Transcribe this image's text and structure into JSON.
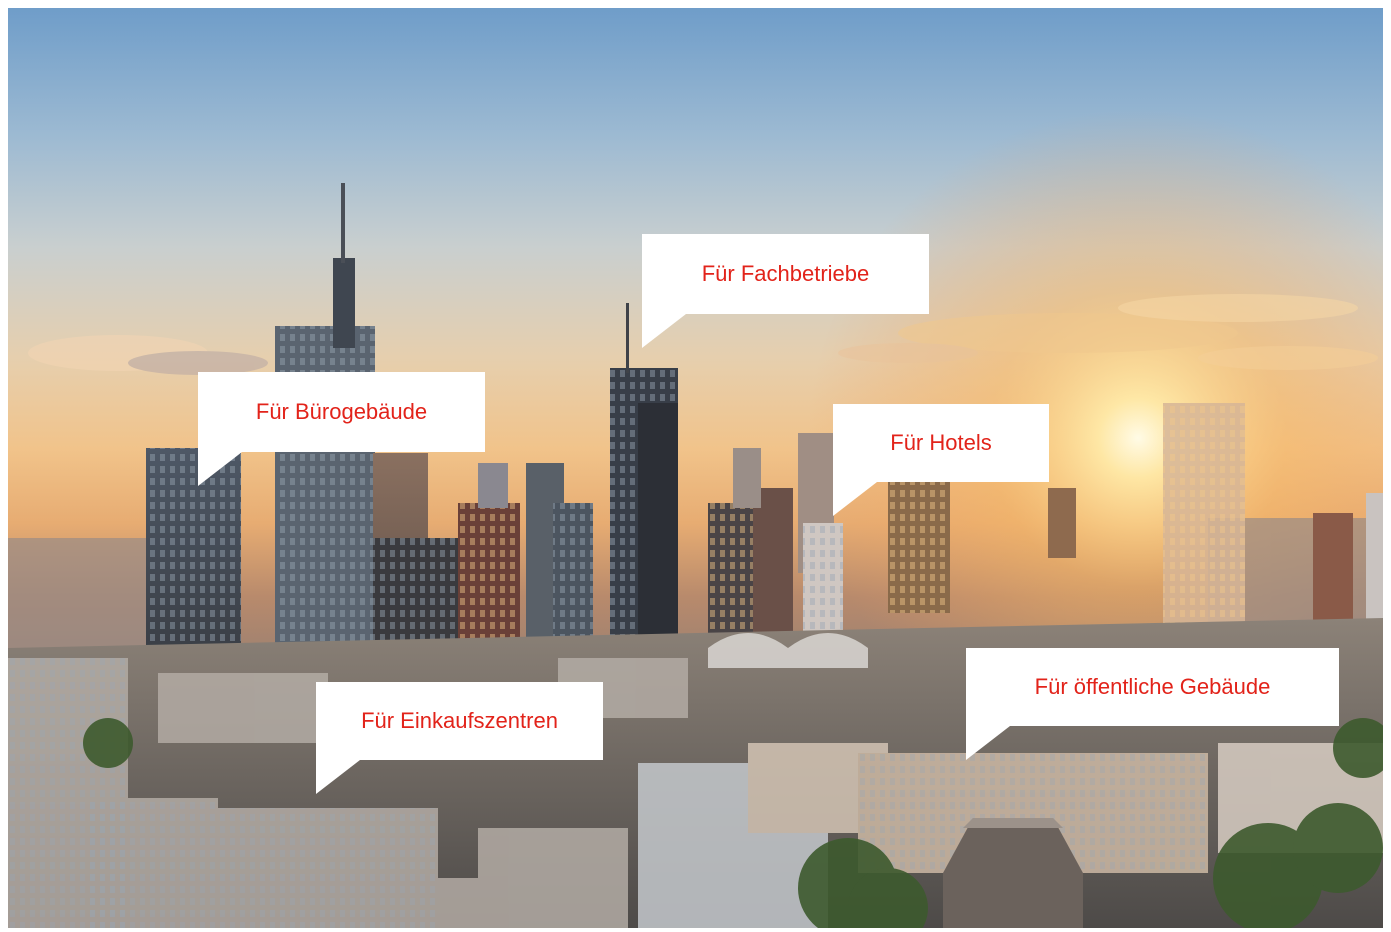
{
  "labels": {
    "fachbetriebe": "Für Fachbetriebe",
    "buerogebaeude": "Für Bürogebäude",
    "hotels": "Für Hotels",
    "einkaufszentren": "Für Einkaufszentren",
    "oeffentliche": "Für öffentliche Gebäude"
  },
  "colors": {
    "label_text": "#e2231a",
    "label_background": "#ffffff"
  }
}
